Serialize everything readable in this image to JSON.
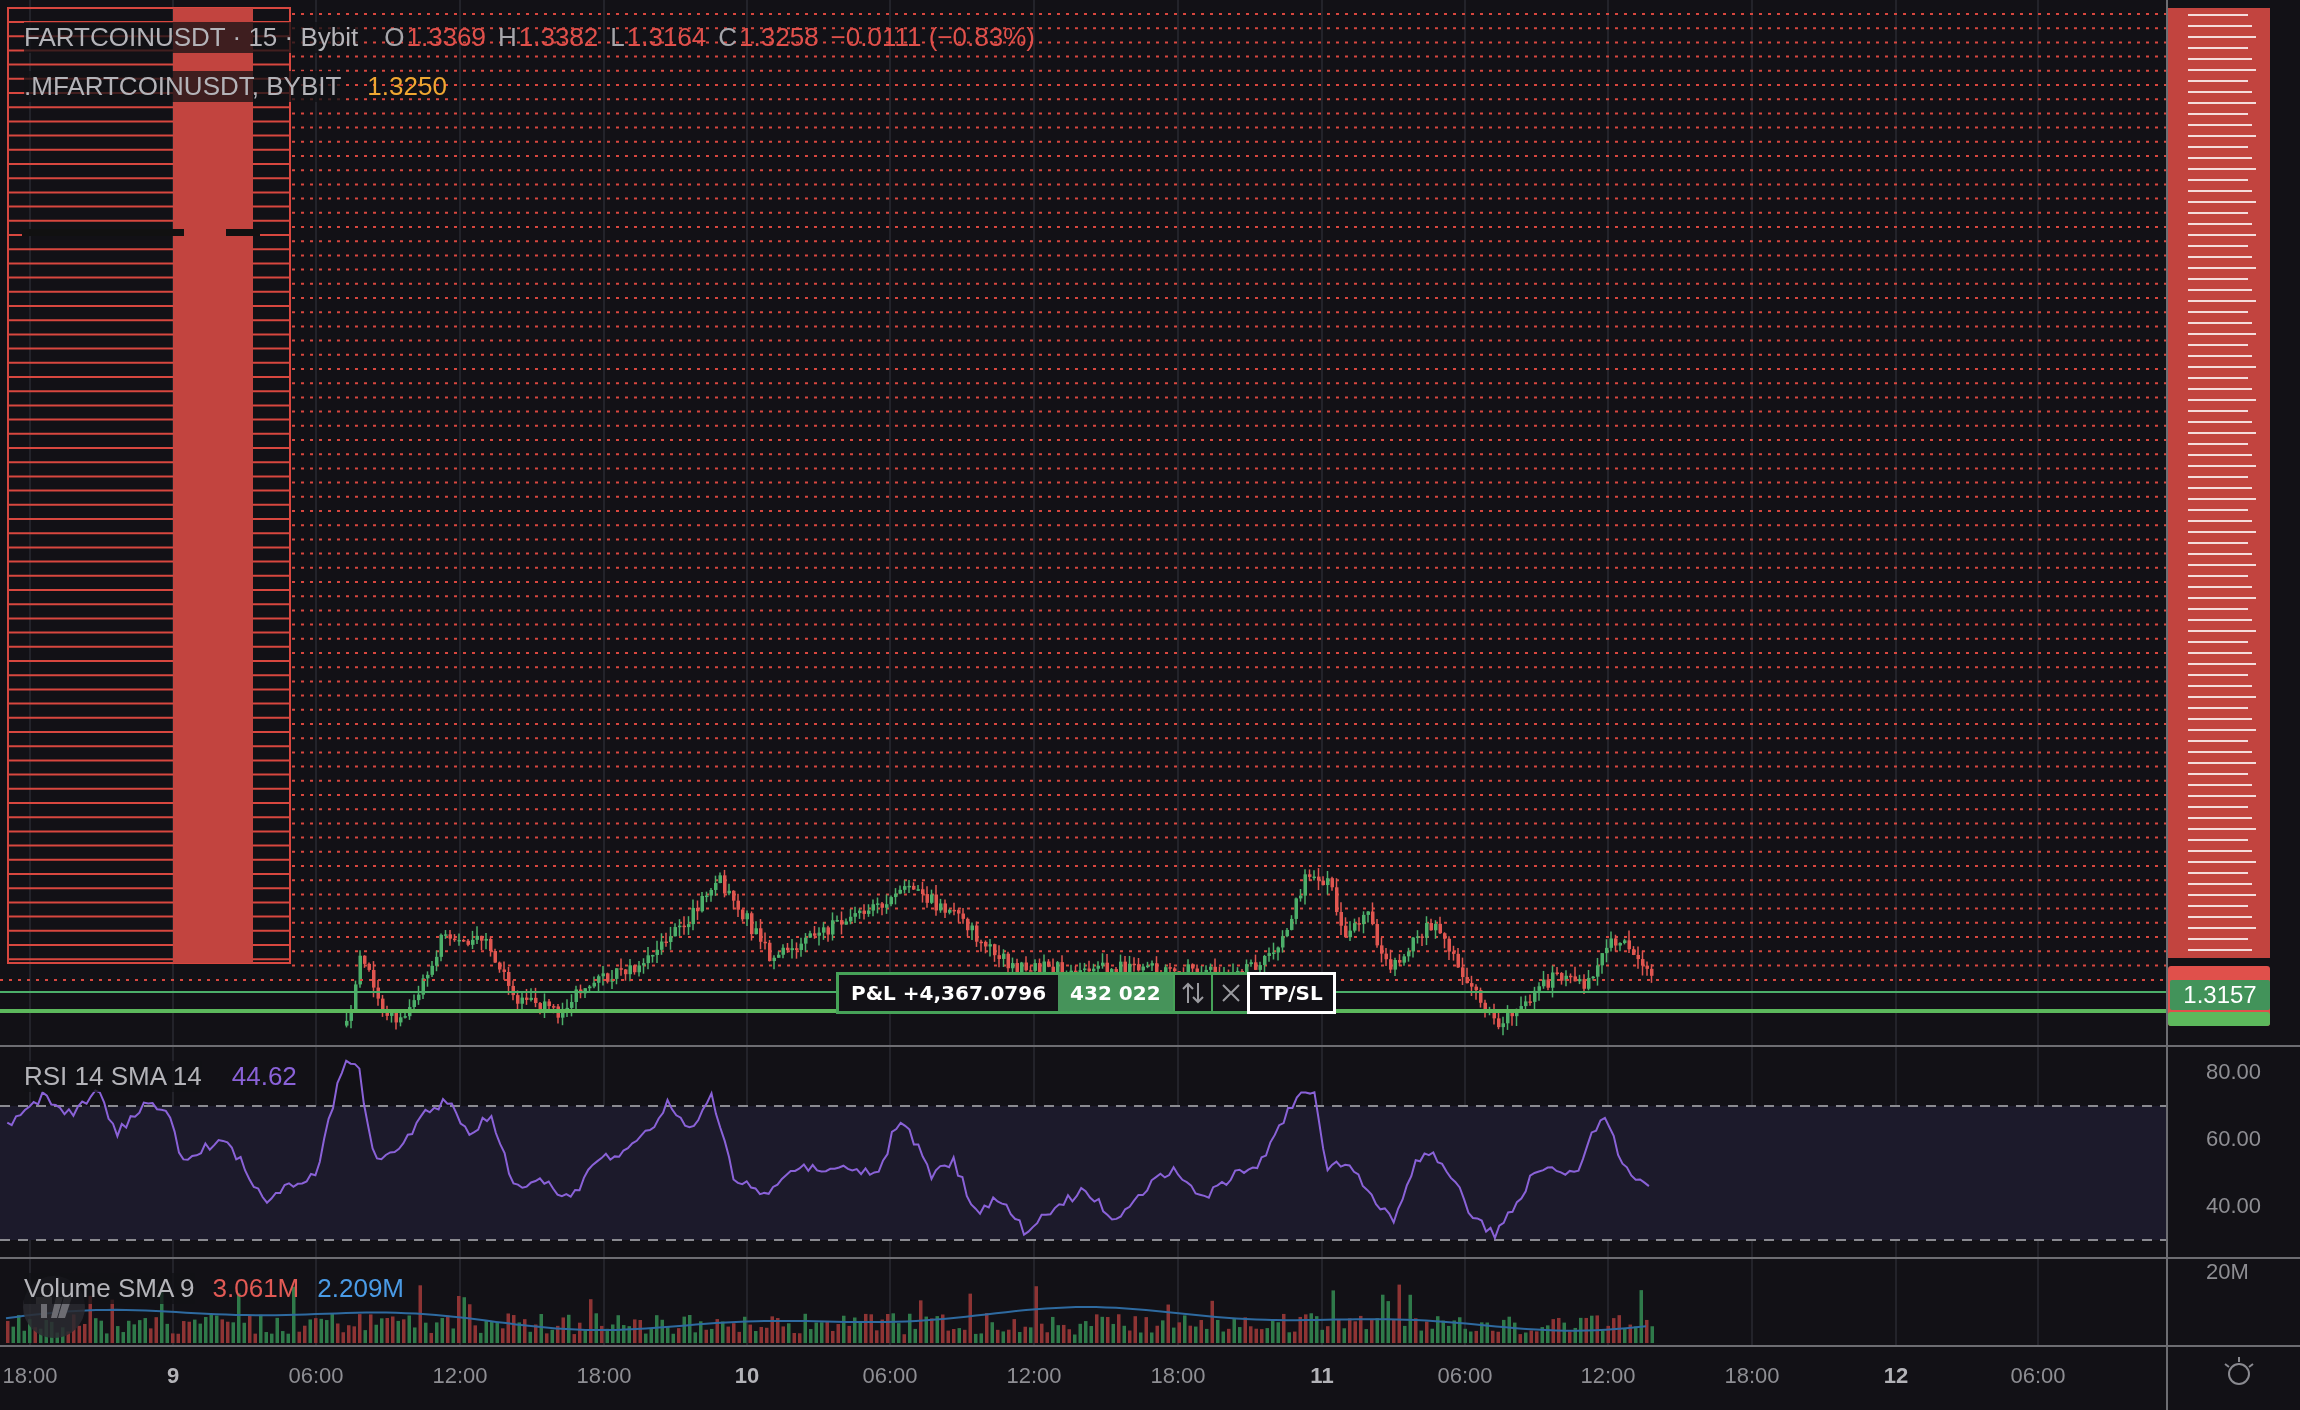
{
  "legend": {
    "title": "FARTCOINUSDT · 15 · Bybit",
    "ohlc": [
      {
        "label": "O",
        "value": "1.3369"
      },
      {
        "label": "H",
        "value": "1.3382"
      },
      {
        "label": "L",
        "value": "1.3164"
      },
      {
        "label": "C",
        "value": "1.3258"
      }
    ],
    "change": "−0.0111 (−0.83%)"
  },
  "mark_price": {
    "symbol": ".MFARTCOINUSDT, BYBIT",
    "value": "1.3250"
  },
  "position": {
    "pnl": "P&L +4,367.0796",
    "quantity": "432 022",
    "tpsl": "TP/SL"
  },
  "price_axis": {
    "last_price": "1.3157"
  },
  "rsi": {
    "title": "RSI 14 SMA 14",
    "value": "44.62",
    "ticks": [
      "80.00",
      "60.00",
      "40.00"
    ]
  },
  "volume": {
    "title": "Volume SMA 9",
    "tick": "20M",
    "values": [
      {
        "text": "3.061M",
        "color": "#e25a55"
      },
      {
        "text": "2.209M",
        "color": "#4a9be6"
      }
    ]
  },
  "time_axis": [
    {
      "label": "18:00",
      "kind": "time"
    },
    {
      "label": "9",
      "kind": "day"
    },
    {
      "label": "06:00",
      "kind": "time"
    },
    {
      "label": "12:00",
      "kind": "time"
    },
    {
      "label": "18:00",
      "kind": "time"
    },
    {
      "label": "10",
      "kind": "day"
    },
    {
      "label": "06:00",
      "kind": "time"
    },
    {
      "label": "12:00",
      "kind": "time"
    },
    {
      "label": "18:00",
      "kind": "time"
    },
    {
      "label": "11",
      "kind": "day"
    },
    {
      "label": "06:00",
      "kind": "time"
    },
    {
      "label": "12:00",
      "kind": "time"
    },
    {
      "label": "18:00",
      "kind": "time"
    },
    {
      "label": "12",
      "kind": "day"
    },
    {
      "label": "06:00",
      "kind": "time"
    }
  ]
}
